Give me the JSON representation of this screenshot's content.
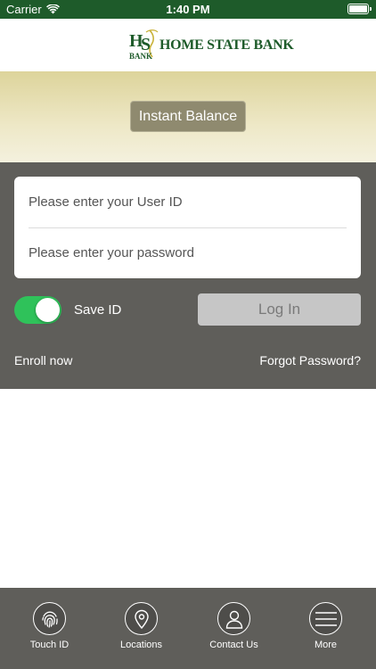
{
  "status_bar": {
    "carrier": "Carrier",
    "time": "1:40 PM"
  },
  "header": {
    "logo_text": "HOME STATE BANK",
    "logo_mark_text": "BANK",
    "brand_color": "#1e5b2a"
  },
  "balance": {
    "button_label": "Instant Balance"
  },
  "login": {
    "user_placeholder": "Please enter your User ID",
    "password_placeholder": "Please enter your password",
    "save_id_label": "Save ID",
    "save_id_on": true,
    "login_label": "Log In",
    "enroll_label": "Enroll now",
    "forgot_label": "Forgot Password?"
  },
  "tabs": [
    {
      "label": "Touch ID",
      "icon": "fingerprint-icon"
    },
    {
      "label": "Locations",
      "icon": "location-pin-icon"
    },
    {
      "label": "Contact Us",
      "icon": "person-icon"
    },
    {
      "label": "More",
      "icon": "hamburger-menu-icon"
    }
  ],
  "colors": {
    "panel": "#5f5e5a",
    "toggle_on": "#2fc25a",
    "instant_button": "#8f8a6f"
  }
}
